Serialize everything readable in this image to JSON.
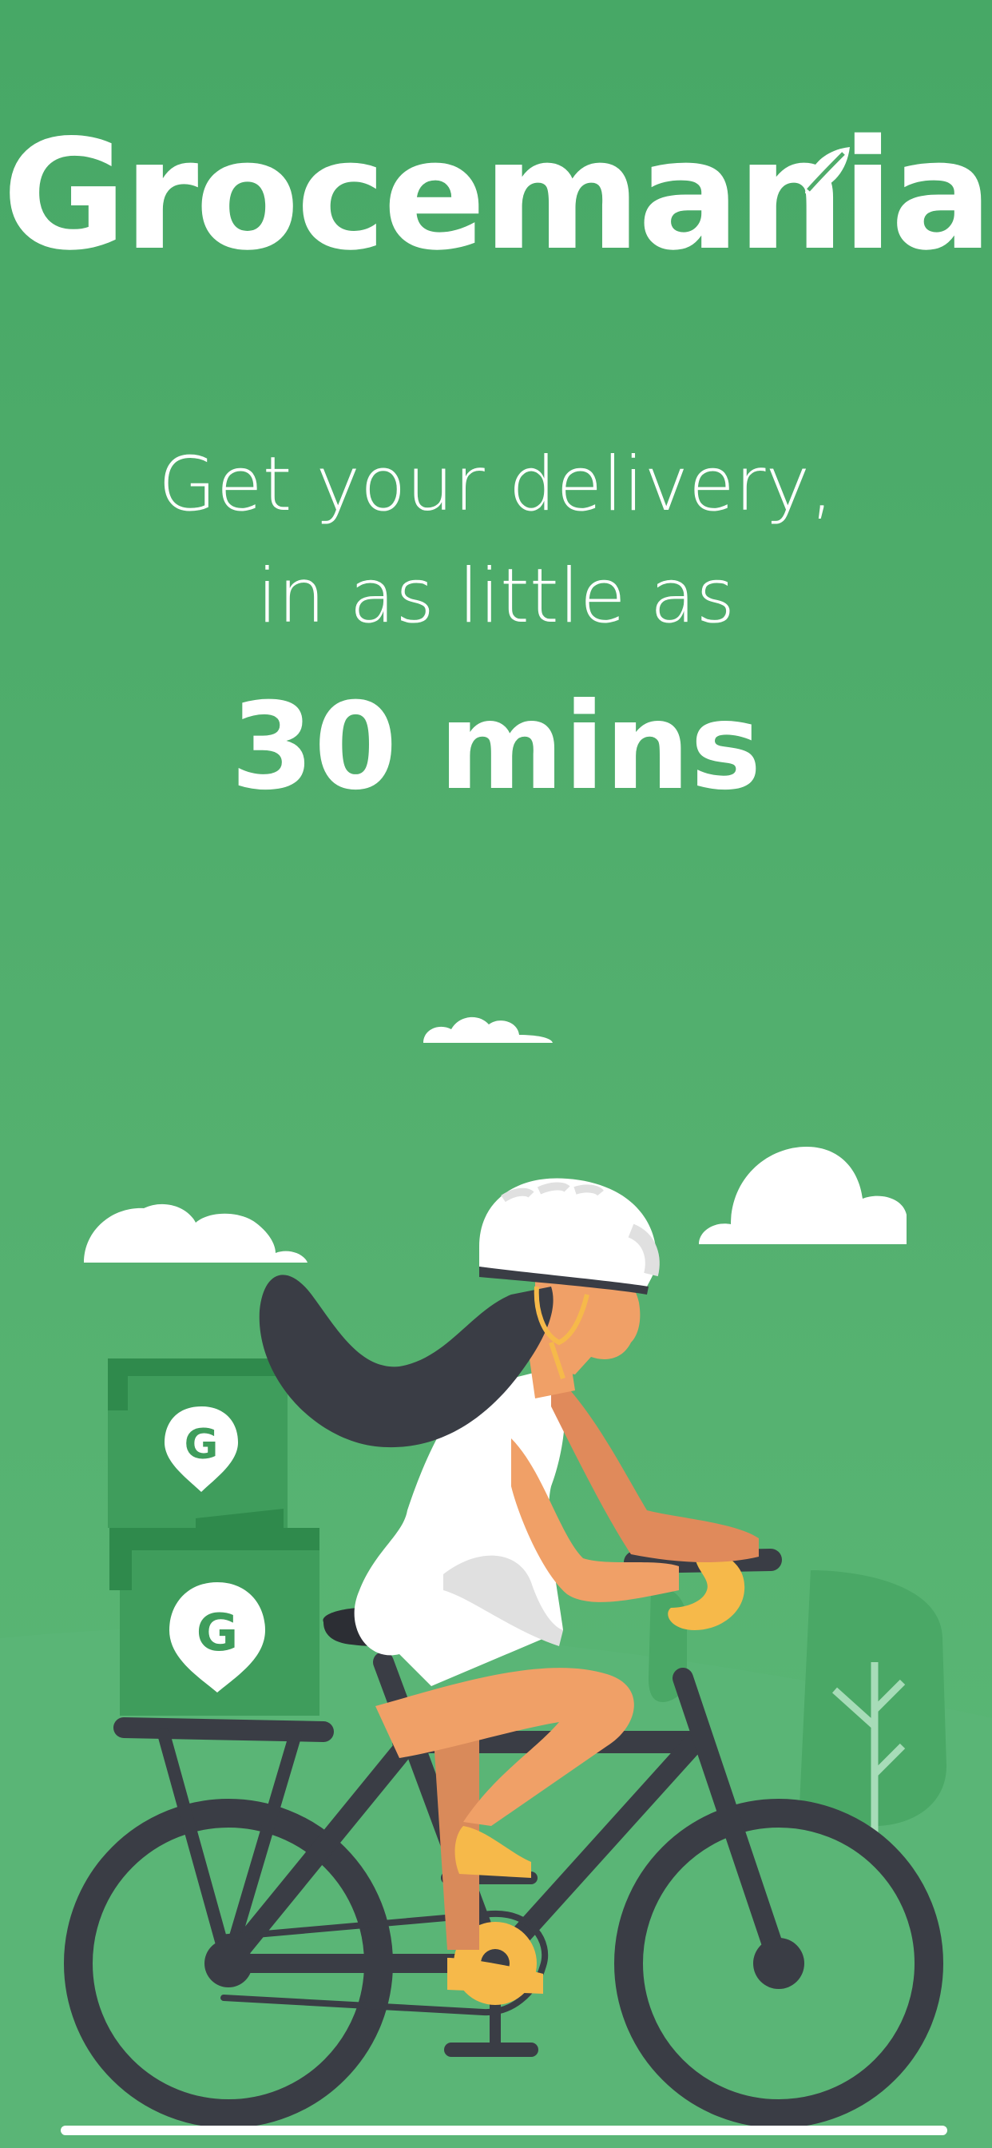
{
  "app": {
    "logo_text": "Grocemania"
  },
  "hero": {
    "line1": "Get your delivery,",
    "line2": "in as little as",
    "highlight": "30 mins"
  },
  "illustration": {
    "box_letter_top": "G",
    "box_letter_bottom": "G"
  },
  "colors": {
    "background": "#4fac6b",
    "text": "#ffffff",
    "bike_frame": "#3a3d45",
    "accent_yellow": "#f6b94a",
    "skin": "#f0a067"
  },
  "icons": [
    "leaf-icon",
    "cloud-icon",
    "delivery-box-icon",
    "location-pin-icon",
    "bicycle-icon",
    "tree-icon"
  ]
}
